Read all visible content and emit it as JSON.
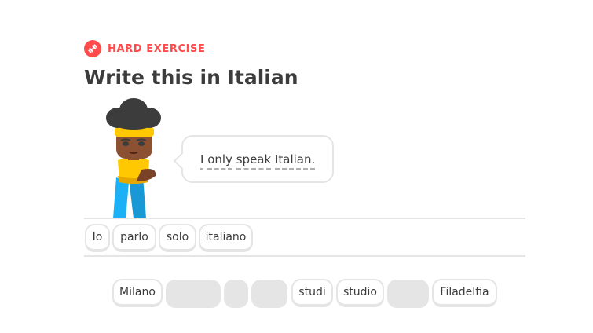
{
  "header": {
    "badge_label": "HARD EXERCISE",
    "badge_icon": "dumbbell-icon",
    "accent_color": "#ff4b4b"
  },
  "title": "Write this in Italian",
  "prompt": {
    "words": [
      "I",
      "only",
      "speak",
      "Italian."
    ]
  },
  "answer": {
    "tiles": [
      "Io",
      "parlo",
      "solo",
      "italiano"
    ]
  },
  "word_bank": {
    "visible_tiles": [
      "Milano",
      "studi",
      "studio",
      "Filadelfia"
    ],
    "used_slot_count": 4
  }
}
